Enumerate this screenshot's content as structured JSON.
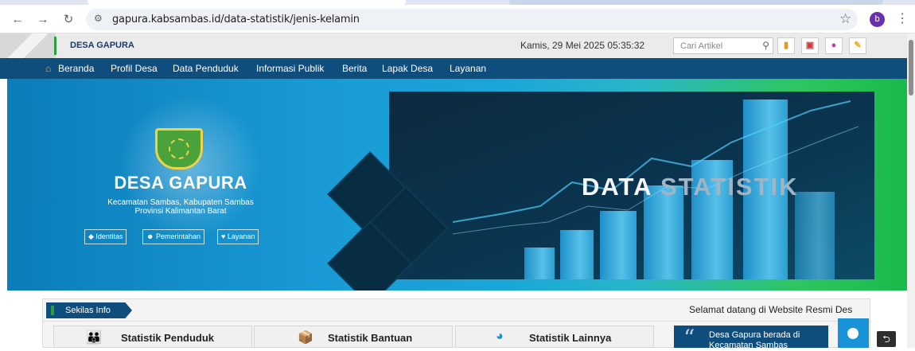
{
  "browser": {
    "url": "gapura.kabsambas.id/data-statistik/jenis-kelamin",
    "profile_initial": "b",
    "icons": [
      "back-icon",
      "forward-icon",
      "reload-icon",
      "site-info-icon",
      "bookmark-star-icon",
      "menu-icon"
    ]
  },
  "topbar": {
    "brand": "DESA GAPURA",
    "datetime": "Kamis, 29 Mei 2025  05:35:32",
    "search_placeholder": "Cari Artikel"
  },
  "nav": {
    "items": [
      "Beranda",
      "Profil Desa",
      "Data Penduduk",
      "Informasi Publik",
      "Berita",
      "Lapak Desa",
      "Layanan"
    ]
  },
  "hero": {
    "title": "DESA GAPURA",
    "subtitle_1": "Kecamatan Sambas, Kabupaten Sambas",
    "subtitle_2": "Provinsi Kalimantan Barat",
    "buttons": [
      "Identitas",
      "Pemerintahan",
      "Layanan"
    ],
    "banner_word_1": "DATA",
    "banner_word_2": "STATISTIK"
  },
  "info": {
    "tag": "Sekilas Info",
    "ticker": "Selamat datang di Website Resmi Des",
    "cards": [
      "Statistik Penduduk",
      "Statistik Bantuan",
      "Statistik Lainnya"
    ],
    "quote": "Desa Gapura berada di Kecamatan Sambas"
  },
  "colors": {
    "nav_bg": "#0f4d7c",
    "accent_green": "#2e9d3e",
    "home_icon": "#f2a51d"
  }
}
